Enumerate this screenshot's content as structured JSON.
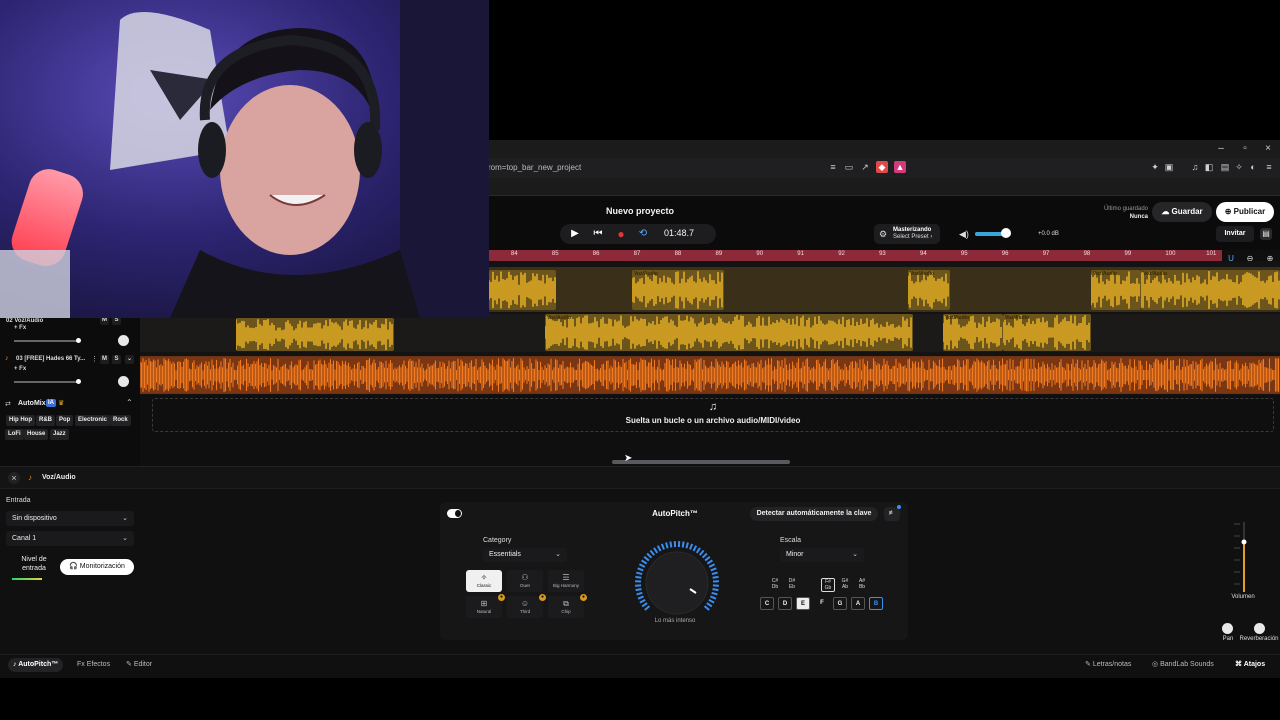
{
  "browser": {
    "url": "rom=top_bar_new_project",
    "window_controls": [
      "–",
      "▫",
      "×"
    ]
  },
  "header": {
    "project_title": "Nuevo proyecto",
    "time": "01:48.7",
    "mastering_title": "Masterizando",
    "mastering_sub": "Select Preset ›",
    "gain": "+0.0 dB",
    "last_saved_label": "Último guardado",
    "last_saved_value": "Nunca",
    "save_label": "Guardar",
    "publish_label": "Publicar",
    "invite_label": "Invitar",
    "volume_level": 0.83
  },
  "ruler": {
    "ticks": [
      "84",
      "85",
      "86",
      "87",
      "88",
      "89",
      "90",
      "91",
      "92",
      "93",
      "94",
      "95",
      "96",
      "97",
      "98",
      "99",
      "100",
      "101"
    ]
  },
  "tracks": [
    {
      "number": "02",
      "name": "Voz/Audio",
      "fx": "+ Fx",
      "m": "M",
      "s": "S",
      "clip_label": "Voz/Audio"
    },
    {
      "number": "03",
      "name": "[FREE] Hades 66 Ty...",
      "fx": "+ Fx",
      "m": "M",
      "s": "S"
    }
  ],
  "automix": {
    "label": "AutoMix",
    "badge": "IA",
    "genres": [
      "Hip Hop",
      "R&B",
      "Pop",
      "Electronic",
      "Rock",
      "LoFi",
      "House",
      "Jazz"
    ]
  },
  "dropzone": {
    "text": "Suelta un bucle o un archivo audio/MIDI/video"
  },
  "editor": {
    "track_title": "Voz/Audio",
    "input_label": "Entrada",
    "device": "Sin dispositivo",
    "channel": "Canal 1",
    "input_level_label": "Nivel de entrada",
    "monitor_label": "Monitorización",
    "autopitch": {
      "title": "AutoPitch™",
      "detect_label": "Detectar automáticamente la clave",
      "category_label": "Category",
      "category_value": "Essentials",
      "tiles": [
        "Classic",
        "Duet",
        "Big Harmony",
        "Natural",
        "Third",
        "Chip"
      ],
      "dial_label": "Lo más intenso",
      "scale_label": "Escala",
      "scale_value": "Minor",
      "accidentals": [
        "C#",
        "Db",
        "D#",
        "Eb",
        "F#",
        "Gb",
        "G#",
        "Ab",
        "A#",
        "Bb"
      ],
      "keys": [
        "C",
        "D",
        "E",
        "F",
        "G",
        "A",
        "B"
      ]
    },
    "volume_label": "Volumen",
    "pan_label": "Pan",
    "reverb_label": "Reverberación"
  },
  "bottom_tabs": {
    "autopitch": "AutoPitch™",
    "effects": "Efectos",
    "editor": "Editor",
    "lyrics": "Letras/notas",
    "sounds": "BandLab Sounds",
    "shortcuts": "Atajos"
  },
  "colors": {
    "vocal_clip": "#f2b825",
    "beat_clip": "#f27a1e",
    "ruler": "#8c2a3a",
    "record": "#e0353a"
  }
}
